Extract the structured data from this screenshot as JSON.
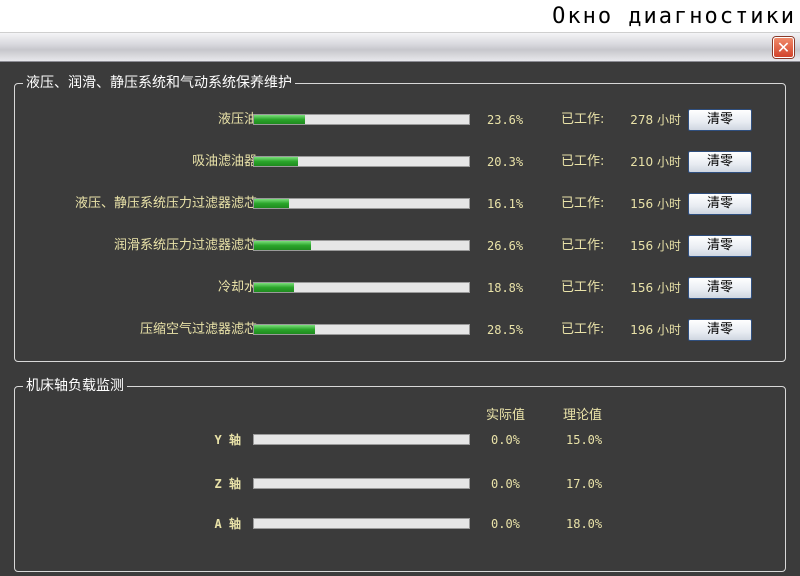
{
  "caption": "Окно диагностики",
  "window": {
    "close_icon": "✕"
  },
  "maintenance": {
    "title": "液压、润滑、静压系统和气动系统保养维护",
    "worked_label": "已工作:",
    "reset_label": "清零",
    "items": [
      {
        "label": "液压油",
        "percent_text": "23.6%",
        "percent": 23.6,
        "hours_text": "278 小时"
      },
      {
        "label": "吸油滤油器",
        "percent_text": "20.3%",
        "percent": 20.3,
        "hours_text": "210 小时"
      },
      {
        "label": "液压、静压系统压力过滤器滤芯",
        "percent_text": "16.1%",
        "percent": 16.1,
        "hours_text": "156 小时"
      },
      {
        "label": "润滑系统压力过滤器滤芯",
        "percent_text": "26.6%",
        "percent": 26.6,
        "hours_text": "156 小时"
      },
      {
        "label": "冷却水",
        "percent_text": "18.8%",
        "percent": 18.8,
        "hours_text": "156 小时"
      },
      {
        "label": "压缩空气过滤器滤芯",
        "percent_text": "28.5%",
        "percent": 28.5,
        "hours_text": "196 小时"
      }
    ]
  },
  "load": {
    "title": "机床轴负载监测",
    "actual_header": "实际值",
    "theory_header": "理论值",
    "axes": [
      {
        "label": "Y 轴",
        "actual": "0.0%",
        "theory": "15.0%",
        "fill": 0
      },
      {
        "label": "Z 轴",
        "actual": "0.0%",
        "theory": "17.0%",
        "fill": 0
      },
      {
        "label": "A 轴",
        "actual": "0.0%",
        "theory": "18.0%",
        "fill": 0
      }
    ]
  },
  "colors": {
    "fill_green": "#2aa52a",
    "label_yellow": "#e9e2a8",
    "panel_bg": "#3b3b3b"
  }
}
